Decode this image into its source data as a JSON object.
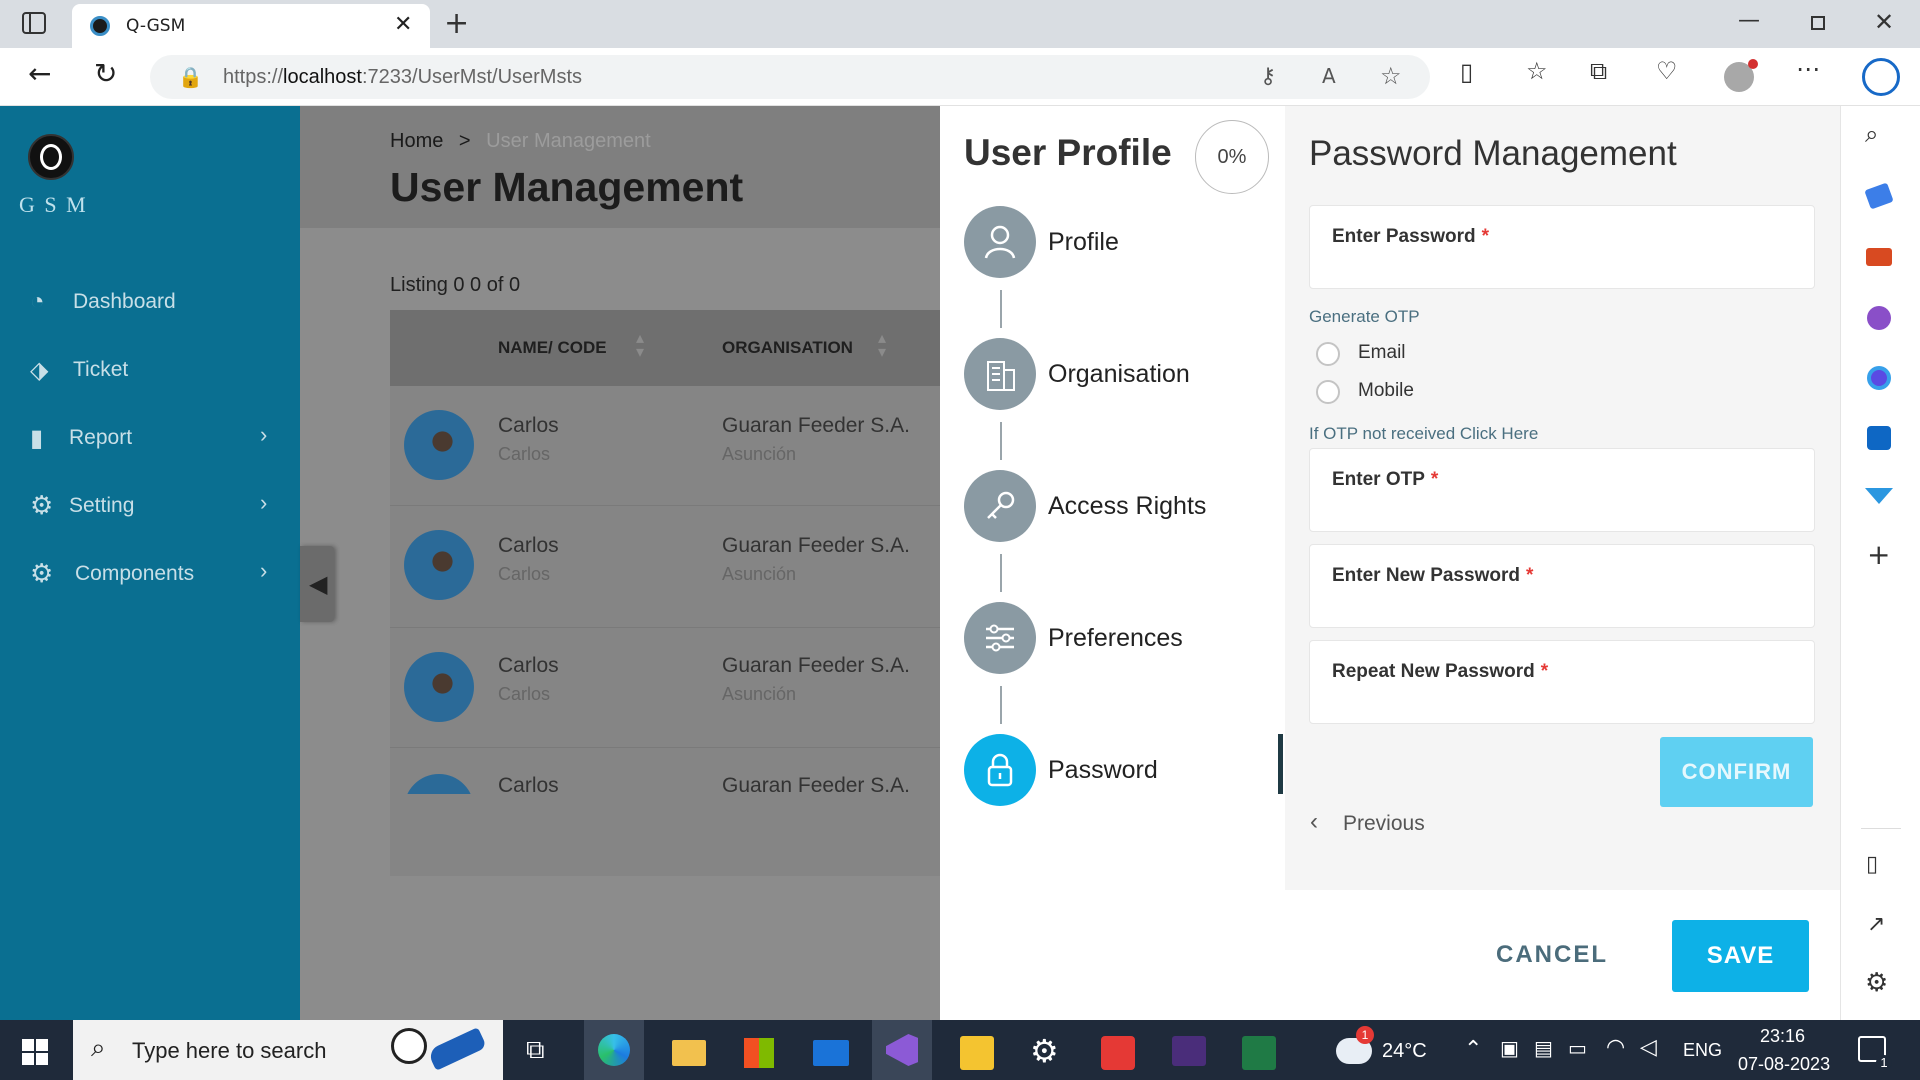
{
  "browser": {
    "tab_title": "Q-GSM",
    "url_prefix": "https://",
    "url_host": "localhost",
    "url_rest": ":7233/UserMst/UserMsts"
  },
  "app": {
    "logo_text": "G S M",
    "nav": [
      {
        "label": "Dashboard",
        "icon": "dashboard-icon"
      },
      {
        "label": "Ticket",
        "icon": "ticket-icon"
      },
      {
        "label": "Report",
        "icon": "report-icon"
      },
      {
        "label": "Setting",
        "icon": "gear-icon"
      },
      {
        "label": "Components",
        "icon": "components-icon"
      }
    ],
    "breadcrumb": {
      "home": "Home",
      "separator": ">",
      "current": "User Management"
    },
    "page_title": "User Management",
    "listing": "Listing 0 0 of 0",
    "table": {
      "columns": [
        "NAME/ CODE",
        "ORGANISATION"
      ],
      "rows": [
        {
          "name": "Carlos",
          "code": "Carlos",
          "org": "Guaran Feeder S.A.",
          "city": "Asunción"
        },
        {
          "name": "Carlos",
          "code": "Carlos",
          "org": "Guaran Feeder S.A.",
          "city": "Asunción"
        },
        {
          "name": "Carlos",
          "code": "Carlos",
          "org": "Guaran Feeder S.A.",
          "city": "Asunción"
        },
        {
          "name": "Carlos",
          "code": "",
          "org": "Guaran Feeder S.A.",
          "city": ""
        }
      ]
    }
  },
  "drawer": {
    "title": "User Profile",
    "progress": "0%",
    "steps": [
      {
        "label": "Profile",
        "icon": "user-icon",
        "active": false
      },
      {
        "label": "Organisation",
        "icon": "building-icon",
        "active": false
      },
      {
        "label": "Access Rights",
        "icon": "key-icon",
        "active": false
      },
      {
        "label": "Preferences",
        "icon": "sliders-icon",
        "active": false
      },
      {
        "label": "Password",
        "icon": "lock-icon",
        "active": true
      }
    ],
    "section_title": "Password Management",
    "enter_password": "Enter Password",
    "required_mark": "*",
    "generate_otp": "Generate OTP",
    "otp_options": [
      "Email",
      "Mobile"
    ],
    "otp_hint": "If OTP not received Click Here",
    "enter_otp": "Enter OTP",
    "new_password": "Enter New Password",
    "repeat_password": "Repeat New Password",
    "confirm": "CONFIRM",
    "previous": "Previous",
    "cancel": "CANCEL",
    "save": "SAVE"
  },
  "taskbar": {
    "search_placeholder": "Type here to search",
    "weather": "24°C",
    "weather_badge": "1",
    "lang": "ENG",
    "time": "23:16",
    "date": "07-08-2023",
    "notif_count": "1"
  },
  "colors": {
    "sidebar": "#0a6f91",
    "accent": "#0db1e7",
    "confirm_bg": "#5fd0f2"
  }
}
